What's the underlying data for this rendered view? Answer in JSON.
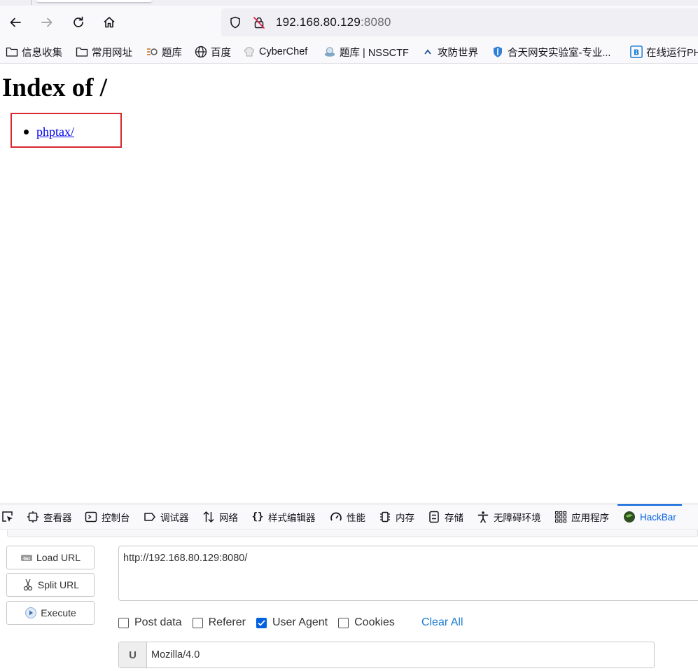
{
  "browser": {
    "address": {
      "host": "192.168.80.129",
      "port": ":8080"
    },
    "bookmarks": [
      {
        "label": "信息收集",
        "icon": "folder-icon"
      },
      {
        "label": "常用网址",
        "icon": "folder-icon"
      },
      {
        "label": "题库",
        "icon": "favicon"
      },
      {
        "label": "百度",
        "icon": "globe-icon"
      },
      {
        "label": "CyberChef",
        "icon": "chef-hat-icon"
      },
      {
        "label": "题库 | NSSCTF",
        "icon": "favicon"
      },
      {
        "label": "攻防世界",
        "icon": "favicon"
      },
      {
        "label": "合天网安实验室-专业...",
        "icon": "shield-icon"
      },
      {
        "label": "在线运行PH",
        "icon": "favicon"
      }
    ]
  },
  "page": {
    "heading": "Index of /",
    "entries": [
      {
        "label": "phptax/"
      }
    ]
  },
  "devtools": {
    "tabs": [
      {
        "label": "查看器",
        "icon": "inspector-icon"
      },
      {
        "label": "控制台",
        "icon": "console-icon"
      },
      {
        "label": "调试器",
        "icon": "debugger-icon"
      },
      {
        "label": "网络",
        "icon": "network-icon"
      },
      {
        "label": "样式编辑器",
        "icon": "braces-icon"
      },
      {
        "label": "性能",
        "icon": "gauge-icon"
      },
      {
        "label": "内存",
        "icon": "memory-icon"
      },
      {
        "label": "存储",
        "icon": "storage-icon"
      },
      {
        "label": "无障碍环境",
        "icon": "accessibility-icon"
      },
      {
        "label": "应用程序",
        "icon": "grid-icon"
      },
      {
        "label": "HackBar",
        "icon": "hackbar-icon",
        "active": true
      }
    ],
    "hackbar": {
      "load_url": "Load URL",
      "split_url": "Split URL",
      "execute": "Execute",
      "url_value": "http://192.168.80.129:8080/",
      "options": {
        "post_data": {
          "label": "Post data",
          "checked": false
        },
        "referer": {
          "label": "Referer",
          "checked": false
        },
        "user_agent": {
          "label": "User Agent",
          "checked": true
        },
        "cookies": {
          "label": "Cookies",
          "checked": false
        }
      },
      "clear_all": "Clear All",
      "ua_badge": "U",
      "ua_value": "Mozilla/4.0"
    }
  },
  "colors": {
    "accent": "#0060df",
    "link": "#0000ee",
    "highlight_box": "#d6282d",
    "clear_all": "#1a7bd1"
  }
}
